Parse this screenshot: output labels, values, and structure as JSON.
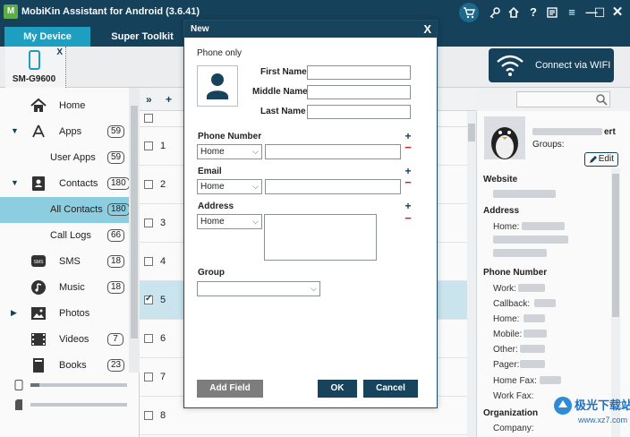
{
  "window": {
    "title": "MobiKin Assistant for Android (3.6.41)"
  },
  "tabs": [
    {
      "label": "My Device"
    },
    {
      "label": "Super Toolkit"
    }
  ],
  "device": {
    "name": "SM-G9600",
    "close": "X"
  },
  "wifi": {
    "label": "Connect via WIFI"
  },
  "sidebar": {
    "items": [
      {
        "label": "Home"
      },
      {
        "label": "Apps",
        "count": "59"
      },
      {
        "label": "User Apps",
        "count": "59"
      },
      {
        "label": "Contacts",
        "count": "180"
      },
      {
        "label": "All Contacts",
        "count": "180"
      },
      {
        "label": "Call Logs",
        "count": "66"
      },
      {
        "label": "SMS",
        "count": "18"
      },
      {
        "label": "Music",
        "count": "18"
      },
      {
        "label": "Photos"
      },
      {
        "label": "Videos",
        "count": "7"
      },
      {
        "label": "Books",
        "count": "23"
      }
    ]
  },
  "table": {
    "rows": [
      "1",
      "2",
      "3",
      "4",
      "5",
      "6",
      "7",
      "8"
    ],
    "selected_row": "5"
  },
  "details": {
    "name": "ert",
    "groups_label": "Groups:",
    "edit_label": "Edit",
    "sections": {
      "website": "Website",
      "address": "Address",
      "phone_number": "Phone Number",
      "organization": "Organization"
    },
    "address_label": "Home:",
    "phone_fields": [
      "Work:",
      "Callback:",
      "Home:",
      "Mobile:",
      "Other:",
      "Pager:",
      "Home Fax:",
      "Work Fax:"
    ],
    "company_label": "Company:"
  },
  "dialog": {
    "title": "New",
    "close": "X",
    "phone_only": "Phone only",
    "first_name": "First Name",
    "middle_name": "Middle Name",
    "last_name": "Last Name",
    "phone_number": "Phone Number",
    "phone_type": "Home",
    "email": "Email",
    "email_type": "Home",
    "address": "Address",
    "address_type": "Home",
    "group": "Group",
    "add_field": "Add Field",
    "ok": "OK",
    "cancel": "Cancel"
  },
  "watermark": {
    "text": "极光下载站",
    "url": "www.xz7.com"
  },
  "colors": {
    "titlebar": "#17435c",
    "accent": "#1fa2c4",
    "selected": "#8fd2e4",
    "danger": "#d01f1f"
  }
}
